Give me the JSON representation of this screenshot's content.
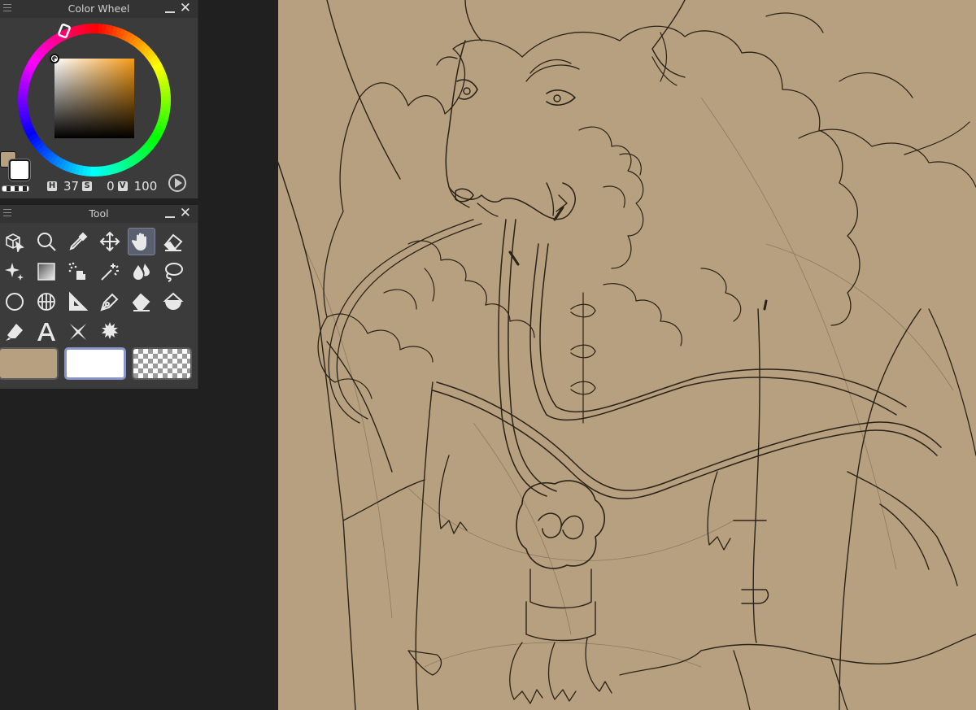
{
  "color_wheel": {
    "title": "Color Wheel",
    "hsv": {
      "h_key": "H",
      "h": "37",
      "s_key": "S",
      "s": "0",
      "v_key": "V",
      "v": "100"
    },
    "main_color": "#b6a07f",
    "sub_color": "#ffffff"
  },
  "tool_panel": {
    "title": "Tool",
    "tools": [
      {
        "name": "operation-tool-icon"
      },
      {
        "name": "zoom-tool-icon"
      },
      {
        "name": "eyedropper-tool-icon"
      },
      {
        "name": "move-layer-tool-icon"
      },
      {
        "name": "hand-tool-icon"
      },
      {
        "name": "eraser-tool-icon"
      },
      {
        "name": "sparkle-tool-icon"
      },
      {
        "name": "gradient-tool-icon"
      },
      {
        "name": "airbrush-tool-icon"
      },
      {
        "name": "auto-select-tool-icon"
      },
      {
        "name": "blend-tool-icon"
      },
      {
        "name": "lasso-tool-icon"
      },
      {
        "name": "ellipse-tool-icon"
      },
      {
        "name": "frame-border-tool-icon"
      },
      {
        "name": "ruler-tool-icon"
      },
      {
        "name": "pen-tool-icon"
      },
      {
        "name": "fill-eraser-tool-icon"
      },
      {
        "name": "fill-tool-icon"
      },
      {
        "name": "correct-line-tool-icon"
      },
      {
        "name": "text-tool-icon"
      },
      {
        "name": "balloon-tool-icon"
      },
      {
        "name": "decoration-tool-icon"
      }
    ],
    "active_tool": "hand-tool-icon",
    "main_color": "#b6a07f",
    "sub_color": "#ffffff",
    "transparent_label": "transparent"
  },
  "colors": {
    "panel_bg": "#3b3b3b",
    "workspace_bg": "#202020",
    "canvas_bg": "#b6a07f",
    "line": "#2b2218"
  }
}
